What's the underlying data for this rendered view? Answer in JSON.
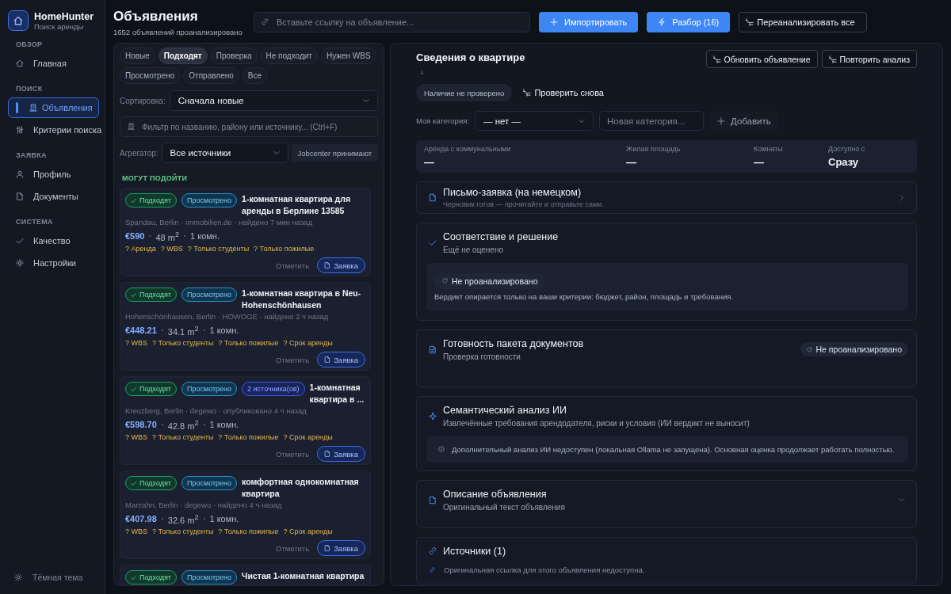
{
  "sidebar": {
    "app_name": "HomeHunter",
    "app_subtitle": "Поиск аренды",
    "groups": [
      {
        "title": "ОБЗОР",
        "items": [
          {
            "label": "Главная",
            "kind": "home",
            "selected": false
          }
        ]
      },
      {
        "title": "ПОИСК",
        "items": [
          {
            "label": "Объявления",
            "kind": "listings",
            "selected": true
          },
          {
            "label": "Критерии поиска",
            "kind": "criteria",
            "selected": false
          }
        ]
      },
      {
        "title": "ЗАЯВКА",
        "items": [
          {
            "label": "Профиль",
            "kind": "profile",
            "selected": false
          },
          {
            "label": "Документы",
            "kind": "documents",
            "selected": false
          }
        ]
      },
      {
        "title": "СИСТЕМА",
        "items": [
          {
            "label": "Качество",
            "kind": "quality",
            "selected": false
          },
          {
            "label": "Настройки",
            "kind": "settings",
            "selected": false
          }
        ]
      }
    ],
    "theme_toggle": "Тёмная тема"
  },
  "header": {
    "title": "Объявления",
    "subtitle": "1652 объявлений проанализировано",
    "link_field": {
      "placeholder": "Вставьте ссылку на объявление..."
    },
    "buttons": [
      {
        "label": "Импортировать",
        "kind": "import"
      },
      {
        "label": "Разбор (16)",
        "kind": "review"
      },
      {
        "label": "Переанализировать все",
        "kind": "reanalyze"
      }
    ]
  },
  "list_panel": {
    "filters": [
      {
        "label": "Новые",
        "selected": false
      },
      {
        "label": "Подходят",
        "selected": true
      },
      {
        "label": "Проверка",
        "selected": false
      },
      {
        "label": "Не подходит",
        "selected": false
      },
      {
        "label": "Нужен WBS",
        "selected": false
      },
      {
        "label": "Просмотрено",
        "selected": false
      },
      {
        "label": "Отправлено",
        "selected": false
      },
      {
        "label": "Все",
        "selected": false
      }
    ],
    "sort": {
      "label": "Сортировка:",
      "value": "Сначала новые"
    },
    "search": {
      "placeholder": "Фильтр по названию, району или источнику... (Ctrl+F)"
    },
    "aggregator": {
      "label": "Агрегатор:",
      "value": "Все источники"
    },
    "jobcenter_button": "Jobcenter принимают",
    "group_title": "МОГУТ ПОДОЙТИ",
    "listings": [
      {
        "badges": [
          {
            "label": "Подходят",
            "kind": "match"
          },
          {
            "label": "Просмотрено",
            "kind": "viewed"
          }
        ],
        "title": "1-комнатная квартира для аренды в Берлине 13585",
        "meta": "Spandau, Berlin · immobilien.de · найдено 7 мин назад",
        "price": "€590",
        "area": "48 m$^{2}$",
        "rooms": "1 комн.",
        "tags": [
          "? Аренда",
          "? WBS",
          "? Только студенты",
          "? Только пожилые"
        ],
        "mark_action": "Отметить",
        "apply_button": "Заявка"
      },
      {
        "badges": [
          {
            "label": "Подходят",
            "kind": "match"
          },
          {
            "label": "Просмотрено",
            "kind": "viewed"
          }
        ],
        "title": "1-комнатная квартира в Neu-Hohenschönhausen",
        "meta": "Hohenschönhausen, Berlin · HOWOGE · найдено 2 ч назад",
        "price": "€448.21",
        "area": "34.1 m$^{2}$",
        "rooms": "1 комн.",
        "tags": [
          "? WBS",
          "? Только студенты",
          "? Только пожилые",
          "? Срок аренды"
        ],
        "mark_action": "Отметить",
        "apply_button": "Заявка"
      },
      {
        "badges": [
          {
            "label": "Подходят",
            "kind": "match"
          },
          {
            "label": "Просмотрено",
            "kind": "viewed"
          },
          {
            "label": "2 источника(ов)",
            "kind": "sources"
          }
        ],
        "title": "1-комнатная квартира в ...",
        "meta": "Kreuzberg, Berlin · degewo · опубликовано 4 ч назад",
        "price": "€598.70",
        "area": "42.8 m$^{2}$",
        "rooms": "1 комн.",
        "tags": [
          "? WBS",
          "? Только студенты",
          "? Только пожилые",
          "? Срок аренды"
        ],
        "mark_action": "Отметить",
        "apply_button": "Заявка"
      },
      {
        "badges": [
          {
            "label": "Подходят",
            "kind": "match"
          },
          {
            "label": "Просмотрено",
            "kind": "viewed"
          }
        ],
        "title": "комфортная однокомнатная квартира",
        "meta": "Marzahn, Berlin · degewo · найдено 4 ч назад",
        "price": "€407.98",
        "area": "32.6 m$^{2}$",
        "rooms": "1 комн.",
        "tags": [
          "? WBS",
          "? Только студенты",
          "? Только пожилые",
          "? Срок аренды"
        ],
        "mark_action": "Отметить",
        "apply_button": "Заявка"
      },
      {
        "badges": [
          {
            "label": "Подходят",
            "kind": "match"
          },
          {
            "label": "Просмотрено",
            "kind": "viewed"
          }
        ],
        "title": "Чистая 1-комнатная квартира"
      }
    ]
  },
  "detail_panel": {
    "title": "Сведения о квартире",
    "actions": [
      "Обновить объявление",
      "Повторить анализ"
    ],
    "availability": {
      "status": "Наличие не проверено",
      "recheck_button": "Проверить снова"
    },
    "category": {
      "label": "Моя категория:",
      "value": "— нет —",
      "new_placeholder": "Новая категория...",
      "add_button": "Добавить"
    },
    "facts": [
      {
        "label": "Аренда с коммунальными",
        "value": "—"
      },
      {
        "label": "Жилая площадь",
        "value": "—"
      },
      {
        "label": "Комнаты",
        "value": "—"
      },
      {
        "label": "Доступно с",
        "value": "Сразу"
      }
    ],
    "sections": [
      {
        "kind": "letter",
        "title": "Письмо-заявка (на немецком)",
        "subtitle": "Черновик готов — прочитайте и отправьте сами."
      },
      {
        "kind": "verdict",
        "title": "Соответствие и решение",
        "subtitle": "Ещё не оценено",
        "panel": {
          "status": "Не проанализировано",
          "text": "Вердикт опирается только на ваши критерии: бюджет, район, площадь и требования."
        }
      },
      {
        "kind": "documents",
        "title": "Готовность пакета документов",
        "subtitle": "Проверка готовности",
        "status": "Не проанализировано"
      },
      {
        "kind": "ai",
        "title": "Семантический анализ ИИ",
        "subtitle": "Извлечённые требования арендодателя, риски и условия (ИИ вердикт не выносит)",
        "panel": {
          "text": "Дополнительный анализ ИИ недоступен (локальная Ollama не запущена). Основная оценка продолжает работать полностью."
        }
      },
      {
        "kind": "description",
        "title": "Описание объявления",
        "subtitle": "Оригинальный текст объявления",
        "expanded": false
      },
      {
        "kind": "sources",
        "title": "Источники (1)",
        "note": "Оригинальная ссылка для этого объявления недоступна."
      }
    ]
  }
}
